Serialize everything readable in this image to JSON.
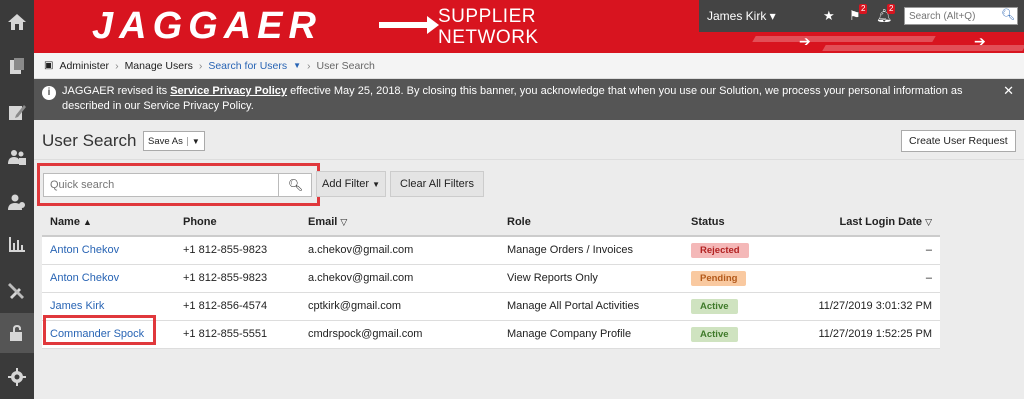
{
  "header": {
    "logo": "JAGGAER",
    "network_line1": "SUPPLIER",
    "network_line2": "NETWORK",
    "user": "James Kirk",
    "flag_count": "2",
    "bell_count": "2",
    "search_placeholder": "Search (Alt+Q)",
    "brand_color": "#d8141f"
  },
  "rail_icons": [
    "home-icon",
    "documents-icon",
    "edit-icon",
    "users-icon",
    "user-admin-icon",
    "reports-icon",
    "tools-icon",
    "lock-icon",
    "settings-icon"
  ],
  "breadcrumb": {
    "items": [
      "Administer",
      "Manage Users",
      "Search for Users",
      "User Search"
    ]
  },
  "banner": {
    "text_before": "JAGGAER revised its ",
    "link": "Service Privacy Policy",
    "text_after": " effective May 25, 2018. By closing this banner, you acknowledge that when you use our Solution, we process your personal information as described in our Service Privacy Policy.",
    "close": "✕"
  },
  "page": {
    "title": "User Search",
    "save_as": "Save As",
    "create_button": "Create User Request",
    "search_placeholder": "Quick search",
    "add_filter": "Add Filter",
    "clear_filters": "Clear All Filters"
  },
  "table": {
    "headers": {
      "name": "Name",
      "phone": "Phone",
      "email": "Email",
      "role": "Role",
      "status": "Status",
      "last_login": "Last Login Date"
    },
    "rows": [
      {
        "name": "Anton Chekov",
        "phone": "+1 812-855-9823",
        "email": "a.chekov@gmail.com",
        "role": "Manage Orders / Invoices",
        "status": "Rejected",
        "last_login": "–"
      },
      {
        "name": "Anton Chekov",
        "phone": "+1 812-855-9823",
        "email": "a.chekov@gmail.com",
        "role": "View Reports Only",
        "status": "Pending",
        "last_login": "–"
      },
      {
        "name": "James Kirk",
        "phone": "+1 812-856-4574",
        "email": "cptkirk@gmail.com",
        "role": "Manage All Portal Activities",
        "status": "Active",
        "last_login": "11/27/2019 3:01:32 PM"
      },
      {
        "name": "Commander Spock",
        "phone": "+1 812-855-5551",
        "email": "cmdrspock@gmail.com",
        "role": "Manage Company Profile",
        "status": "Active",
        "last_login": "11/27/2019 1:52:25 PM"
      }
    ]
  },
  "status_colors": {
    "Rejected": {
      "bg": "#f4b8b8",
      "fg": "#b22222"
    },
    "Pending": {
      "bg": "#f9c9a0",
      "fg": "#b3591a"
    },
    "Active": {
      "bg": "#cfe3c0",
      "fg": "#3f7a2a"
    }
  }
}
